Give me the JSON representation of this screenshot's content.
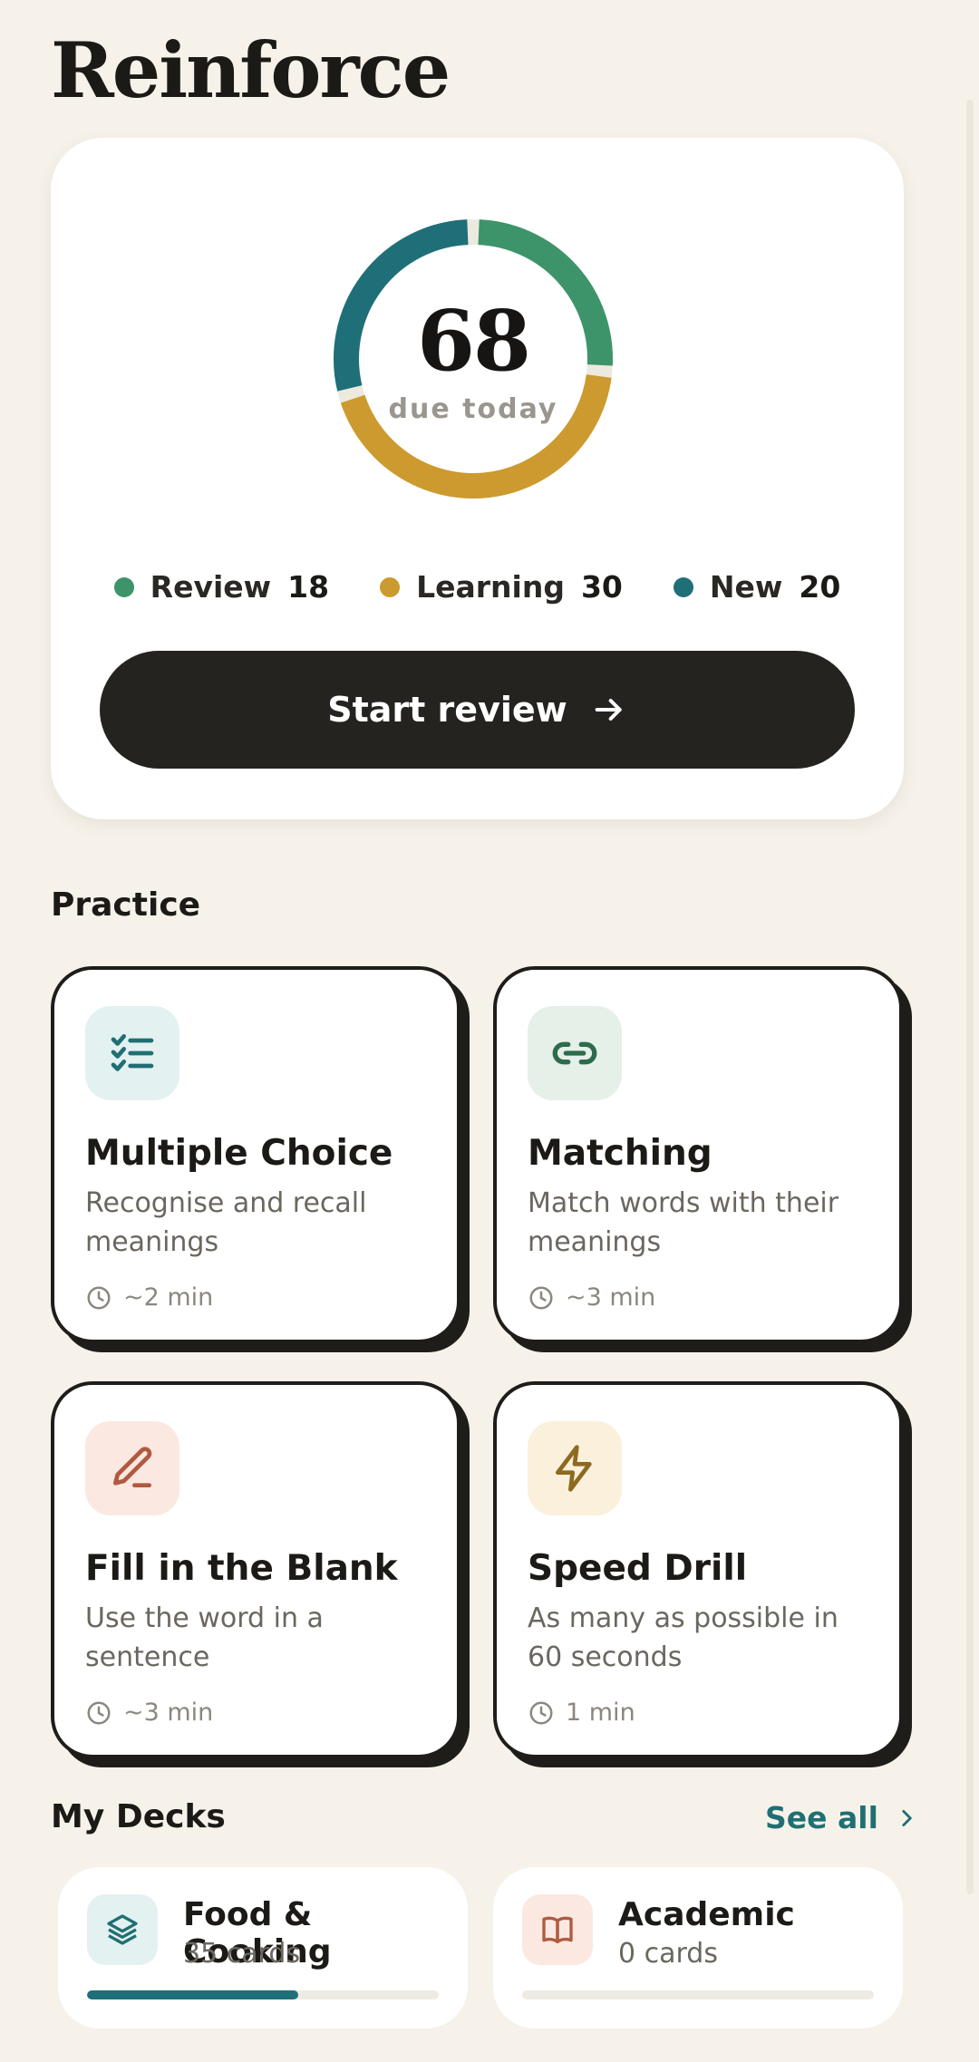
{
  "header": {
    "title": "Reinforce"
  },
  "summary": {
    "due_count": "68",
    "due_label": "due today",
    "segments": [
      {
        "name": "Review",
        "count": 18,
        "color": "#3d946a"
      },
      {
        "name": "Learning",
        "count": 30,
        "color": "#cc9a2e"
      },
      {
        "name": "New",
        "count": 20,
        "color": "#1f6f78"
      }
    ],
    "start_button_label": "Start review"
  },
  "practice": {
    "title": "Practice",
    "modes": [
      {
        "title": "Multiple Choice",
        "description": "Recognise and recall meanings",
        "time": "~2 min",
        "icon": "checklist-icon",
        "icon_bg": "#e4f1f1",
        "icon_color": "#1f6f73"
      },
      {
        "title": "Matching",
        "description": "Match words with their meanings",
        "time": "~3 min",
        "icon": "link-icon",
        "icon_bg": "#e5f0e9",
        "icon_color": "#2e6b4c"
      },
      {
        "title": "Fill in the Blank",
        "description": "Use the word in a sentence",
        "time": "~3 min",
        "icon": "pencil-icon",
        "icon_bg": "#fbe8e1",
        "icon_color": "#b05a40"
      },
      {
        "title": "Speed Drill",
        "description": "As many as possible in 60 seconds",
        "time": "1 min",
        "icon": "lightning-icon",
        "icon_bg": "#fbf0dc",
        "icon_color": "#8d6a20"
      }
    ]
  },
  "decks": {
    "title": "My Decks",
    "see_all_label": "See all",
    "items": [
      {
        "name": "Food & Cooking",
        "count": "35 cards",
        "progress": 0.6,
        "icon": "layers-icon",
        "icon_bg": "#e4f1f1",
        "icon_color": "#1f6f73"
      },
      {
        "name": "Academic",
        "count": "0 cards",
        "progress": 0.0,
        "icon": "book-icon",
        "icon_bg": "#fbe8e1",
        "icon_color": "#b05a40"
      }
    ]
  }
}
